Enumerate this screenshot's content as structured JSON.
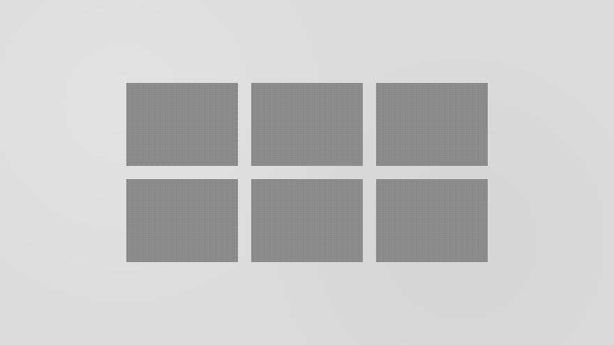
{
  "screen": {
    "background_color": "#dcdcdc"
  },
  "tiles": [
    {
      "color": "#8c8c8c"
    },
    {
      "color": "#8c8c8c"
    },
    {
      "color": "#8c8c8c"
    },
    {
      "color": "#8c8c8c"
    },
    {
      "color": "#8c8c8c"
    },
    {
      "color": "#8c8c8c"
    }
  ]
}
